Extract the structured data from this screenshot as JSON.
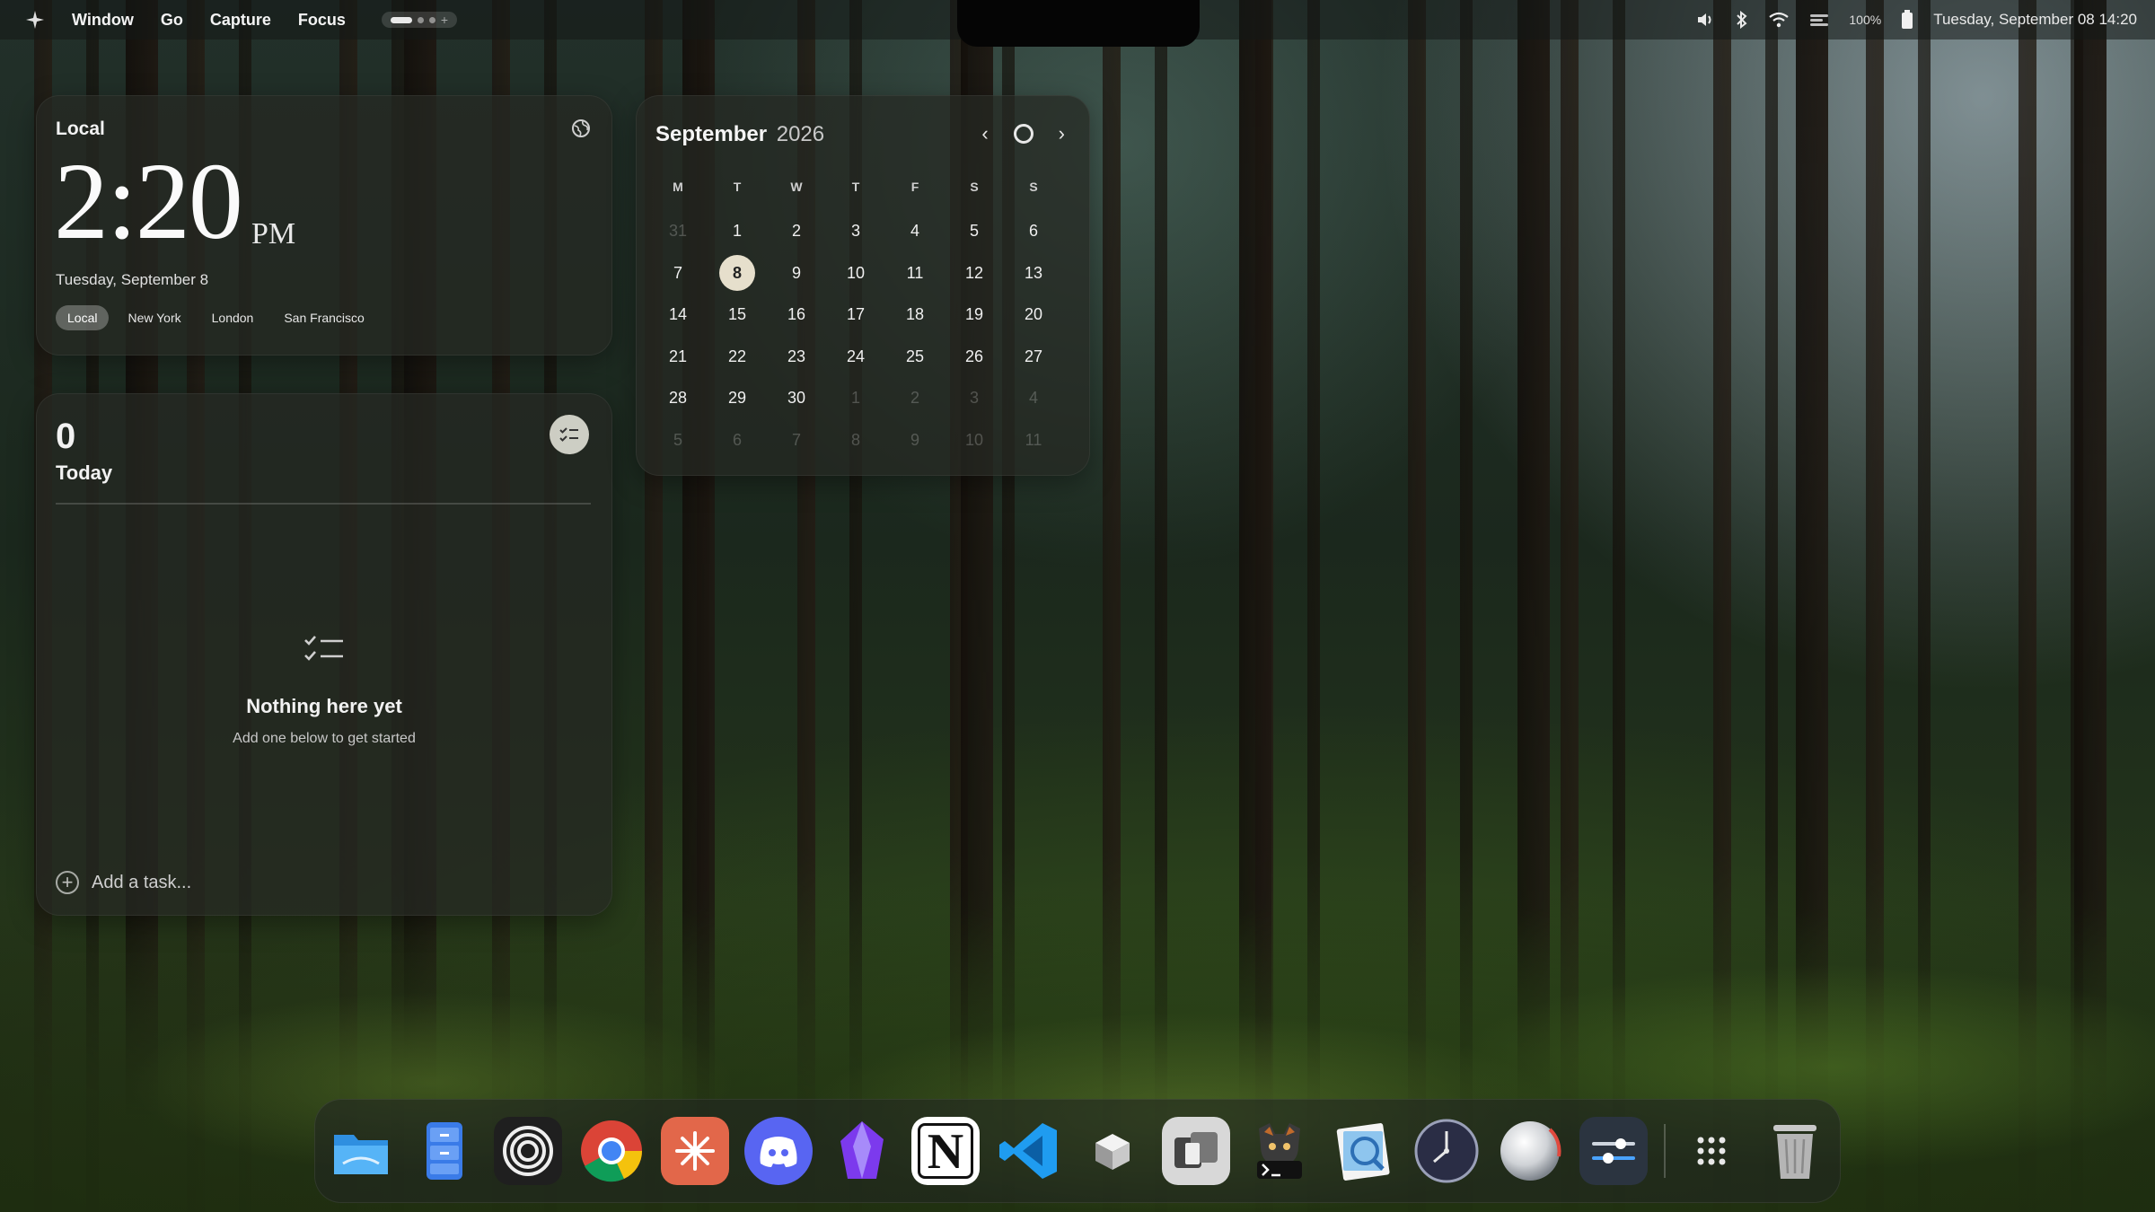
{
  "menubar": {
    "items": [
      "Window",
      "Go",
      "Capture",
      "Focus"
    ],
    "battery": "100%",
    "datetime": "Tuesday, September 08  14:20"
  },
  "clock": {
    "label": "Local",
    "time": "2:20",
    "ampm": "PM",
    "date": "Tuesday, September 8",
    "zones": [
      "Local",
      "New York",
      "London",
      "San Francisco"
    ],
    "active_zone": "Local"
  },
  "tasks": {
    "count": "0",
    "label": "Today",
    "empty_title": "Nothing here yet",
    "empty_sub": "Add one below to get started",
    "add_placeholder": "Add a task..."
  },
  "calendar": {
    "month": "September",
    "year": "2026",
    "weekdays": [
      "M",
      "T",
      "W",
      "T",
      "F",
      "S",
      "S"
    ],
    "days": [
      [
        "31",
        "1",
        "2",
        "3",
        "4",
        "5",
        "6"
      ],
      [
        "7",
        "8",
        "9",
        "10",
        "11",
        "12",
        "13"
      ],
      [
        "14",
        "15",
        "16",
        "17",
        "18",
        "19",
        "20"
      ],
      [
        "21",
        "22",
        "23",
        "24",
        "25",
        "26",
        "27"
      ],
      [
        "28",
        "29",
        "30",
        "1",
        "2",
        "3",
        "4"
      ],
      [
        "5",
        "6",
        "7",
        "8",
        "9",
        "10",
        "11"
      ]
    ],
    "today": "8"
  },
  "dock": {
    "apps": [
      "finder-icon",
      "file-cabinet-icon",
      "target-icon",
      "chrome-icon",
      "claude-icon",
      "discord-icon",
      "obsidian-icon",
      "notion-icon",
      "vscode-icon",
      "cube-icon",
      "window-app-icon",
      "terminal-icon",
      "preview-icon",
      "clock-icon",
      "orb-icon",
      "settings-toggle-icon",
      "launchpad-icon",
      "trash-icon"
    ]
  },
  "colors": {
    "today_badge": "#e6dfcc",
    "widget_bg": "#26281f"
  }
}
